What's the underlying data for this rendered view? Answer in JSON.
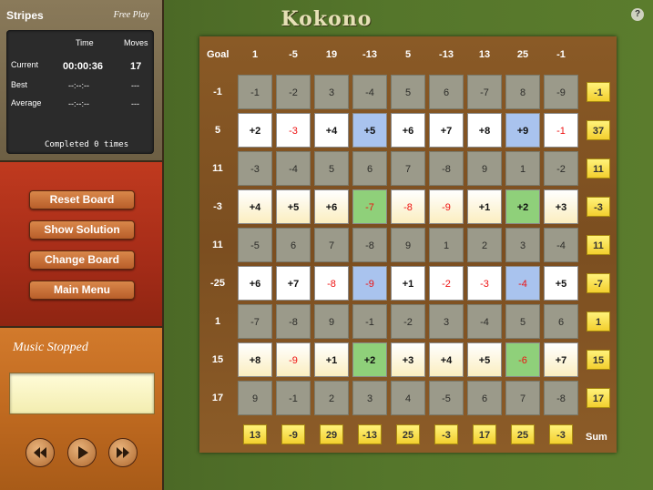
{
  "stats": {
    "puzzle_name": "Stripes",
    "mode": "Free Play",
    "col_time": "Time",
    "col_moves": "Moves",
    "rows": [
      {
        "label": "Current",
        "time": "00:00:36",
        "moves": "17"
      },
      {
        "label": "Best",
        "time": "--:--:--",
        "moves": "---"
      },
      {
        "label": "Average",
        "time": "--:--:--",
        "moves": "---"
      }
    ],
    "completed": "Completed 0 times"
  },
  "controls": {
    "reset": "Reset Board",
    "solution": "Show Solution",
    "change": "Change Board",
    "menu": "Main Menu"
  },
  "music": {
    "status": "Music Stopped",
    "display_text": ""
  },
  "app": {
    "title": "Kokono",
    "help": "?"
  },
  "board": {
    "goal_label": "Goal",
    "sum_label": "Sum",
    "col_goals": [
      "1",
      "-5",
      "19",
      "-13",
      "5",
      "-13",
      "13",
      "25",
      "-1"
    ],
    "row_goals": [
      "-1",
      "5",
      "11",
      "-3",
      "11",
      "-25",
      "1",
      "15",
      "17"
    ],
    "row_sums": [
      "-1",
      "37",
      "11",
      "-3",
      "11",
      "-7",
      "1",
      "15",
      "17"
    ],
    "col_sums": [
      "13",
      "-9",
      "29",
      "-13",
      "25",
      "-3",
      "17",
      "25",
      "-3"
    ],
    "grid": [
      [
        "-1",
        "-2",
        "3",
        "-4",
        "5",
        "6",
        "-7",
        "8",
        "-9"
      ],
      [
        "+2",
        "-3",
        "+4",
        "+5",
        "+6",
        "+7",
        "+8",
        "+9",
        "-1"
      ],
      [
        "-3",
        "-4",
        "5",
        "6",
        "7",
        "-8",
        "9",
        "1",
        "-2"
      ],
      [
        "+4",
        "+5",
        "+6",
        "-7",
        "-8",
        "-9",
        "+1",
        "+2",
        "+3"
      ],
      [
        "-5",
        "6",
        "7",
        "-8",
        "9",
        "1",
        "2",
        "3",
        "-4"
      ],
      [
        "+6",
        "+7",
        "-8",
        "-9",
        "+1",
        "-2",
        "-3",
        "-4",
        "+5"
      ],
      [
        "-7",
        "-8",
        "9",
        "-1",
        "-2",
        "3",
        "-4",
        "5",
        "6"
      ],
      [
        "+8",
        "-9",
        "+1",
        "+2",
        "+3",
        "+4",
        "+5",
        "-6",
        "+7"
      ],
      [
        "9",
        "-1",
        "2",
        "3",
        "4",
        "-5",
        "6",
        "7",
        "-8"
      ]
    ],
    "selected_rows": [
      1,
      3,
      5,
      7
    ],
    "colors": {
      "gray": "#9b9a8a",
      "white": "#ffffff",
      "cream": "#fbeec0",
      "blue": "#a9c3ee",
      "green": "#8fd07a"
    },
    "cell_fill": {
      "1": {
        "3": "blue",
        "7": "blue"
      },
      "3": {
        "3": "green",
        "7": "green",
        "_default": "cream"
      },
      "5": {
        "3": "blue",
        "7": "blue"
      },
      "7": {
        "3": "green",
        "7": "green",
        "_default": "cream"
      }
    }
  }
}
